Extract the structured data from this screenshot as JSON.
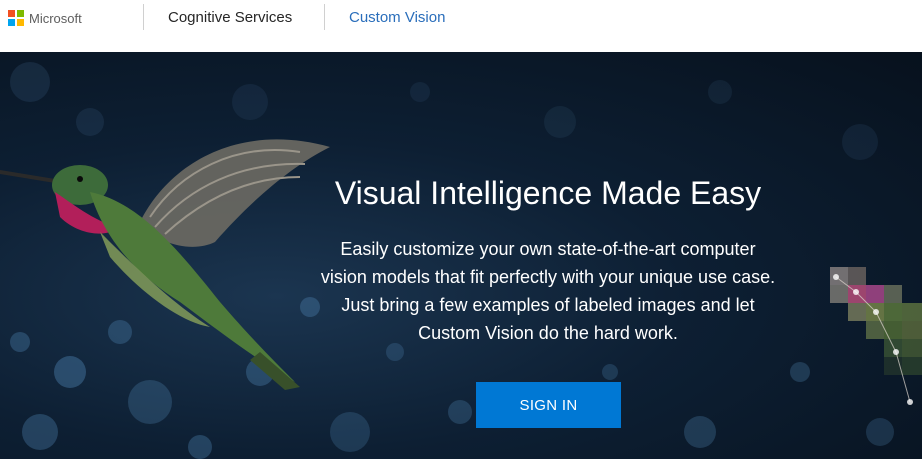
{
  "header": {
    "brand": "Microsoft",
    "nav_items": [
      {
        "label": "Cognitive Services"
      },
      {
        "label": "Custom Vision"
      }
    ]
  },
  "hero": {
    "title": "Visual Intelligence Made Easy",
    "description": "Easily customize your own state-of-the-art computer vision models that fit perfectly with your unique use case. Just bring a few examples of labeled images and let Custom Vision do the hard work.",
    "signin_label": "SIGN IN"
  },
  "colors": {
    "accent": "#0078d4",
    "link": "#2a6ebb",
    "hero_bg": "#0d1f33"
  }
}
